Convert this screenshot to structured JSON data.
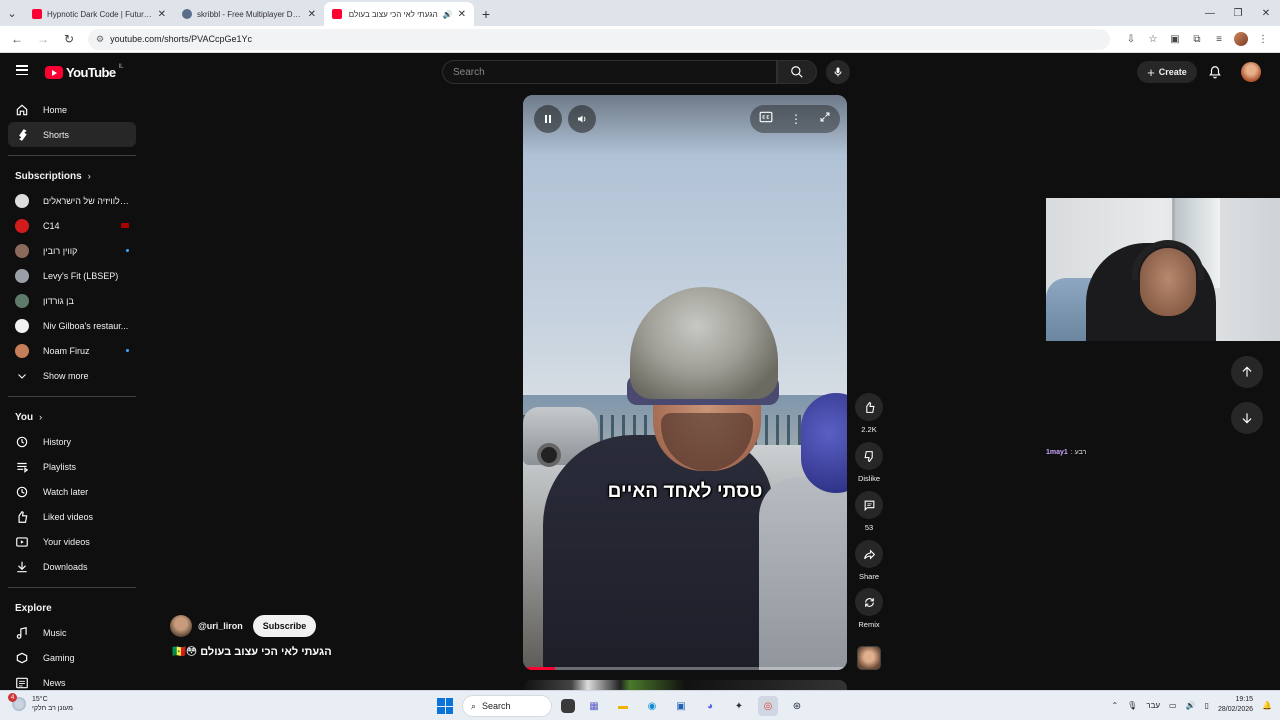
{
  "browser": {
    "tabs": [
      {
        "title": "Hypnotic Dark Code | Futuristic",
        "favicon": "youtube-icon"
      },
      {
        "title": "skribbl - Free Multiplayer Drawi",
        "favicon": "skribbl-icon"
      },
      {
        "title": "הגעתי לאי הכי עצוב בעולם",
        "favicon": "youtube-icon"
      }
    ],
    "url": "youtube.com/shorts/PVACcpGe1Yc"
  },
  "masthead": {
    "logo_text": "YouTube",
    "country_code": "IL",
    "search_placeholder": "Search",
    "create_label": "Create"
  },
  "sidebar": {
    "main": [
      {
        "label": "Home",
        "icon": "home-icon"
      },
      {
        "label": "Shorts",
        "icon": "shorts-icon"
      }
    ],
    "subscriptions_title": "Subscriptions",
    "subscriptions": [
      {
        "label": "טלוויזיה של הישראלים...",
        "color": "#dddddd"
      },
      {
        "label": "C14",
        "color": "#d11c1c"
      },
      {
        "label": "קווין רובין",
        "color": "#8a6a5a"
      },
      {
        "label": "Levy's Fit (LBSEP)",
        "color": "#9aa0a6"
      },
      {
        "label": "בן גורדון",
        "color": "#5d7a6a"
      },
      {
        "label": "Niv Gilboa's restaur...",
        "color": "#f1f1f1"
      },
      {
        "label": "Noam Firuz",
        "color": "#c47f5a"
      }
    ],
    "show_more": "Show more",
    "you_title": "You",
    "you": [
      {
        "label": "History",
        "icon": "history-icon"
      },
      {
        "label": "Playlists",
        "icon": "playlists-icon"
      },
      {
        "label": "Watch later",
        "icon": "watch-later-icon"
      },
      {
        "label": "Liked videos",
        "icon": "like-icon"
      },
      {
        "label": "Your videos",
        "icon": "your-videos-icon"
      },
      {
        "label": "Downloads",
        "icon": "download-icon"
      }
    ],
    "explore_title": "Explore",
    "explore": [
      {
        "label": "Music",
        "icon": "music-icon"
      },
      {
        "label": "Gaming",
        "icon": "gaming-icon"
      },
      {
        "label": "News",
        "icon": "news-icon"
      }
    ]
  },
  "video": {
    "caption": "טסתי לאחד האיים",
    "progress": 0.1,
    "channel_handle": "@uri_liron",
    "subscribe_label": "Subscribe",
    "title": "הגעתי לאי הכי עצוב בעולם 😳🇸🇳"
  },
  "actions": {
    "like_count": "2.2K",
    "dislike_label": "Dislike",
    "comment_count": "53",
    "share_label": "Share",
    "remix_label": "Remix"
  },
  "chat": {
    "prefix": "רבע :",
    "user": "1may1"
  },
  "taskbar": {
    "temperature": "15°C",
    "weather_text": "מעונן רב חלקי",
    "notification_count": "4",
    "search_label": "Search",
    "language": "עבר",
    "time": "19:15",
    "date": "28/02/2026"
  },
  "colors": {
    "accent": "#ff0033",
    "background": "#0f0f0f",
    "surface": "#272727"
  }
}
